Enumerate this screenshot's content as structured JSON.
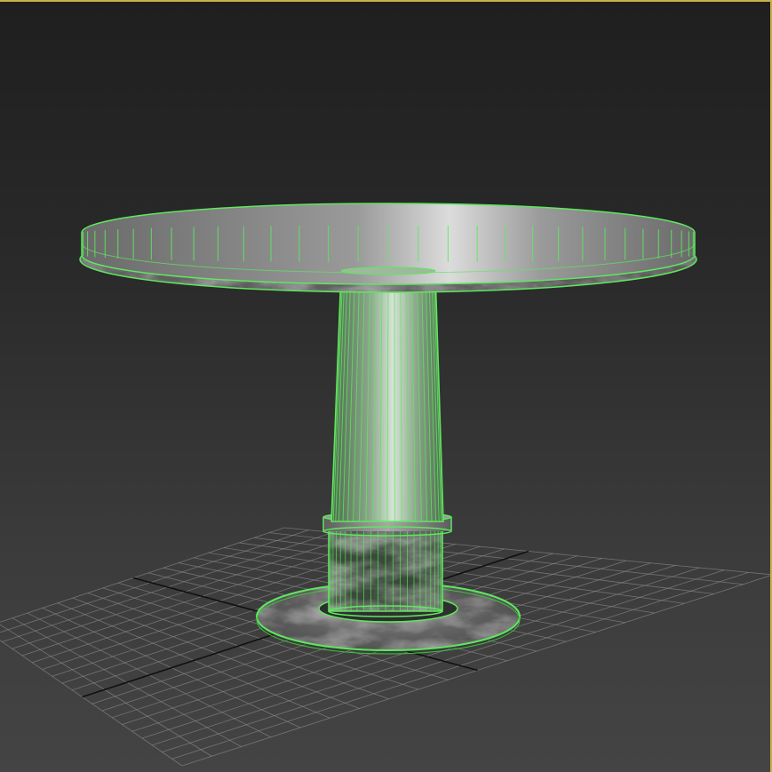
{
  "viewport": {
    "frame_color": "#c8b04a",
    "background_top": "#1f1f1f",
    "background_bottom": "#444444"
  },
  "grid": {
    "line_color": "#8a8a8a",
    "axis_color": "#101010"
  },
  "model": {
    "object": "round-pedestal-table",
    "selection_wire_color": "#5ee85e",
    "material": "gray-marble"
  }
}
